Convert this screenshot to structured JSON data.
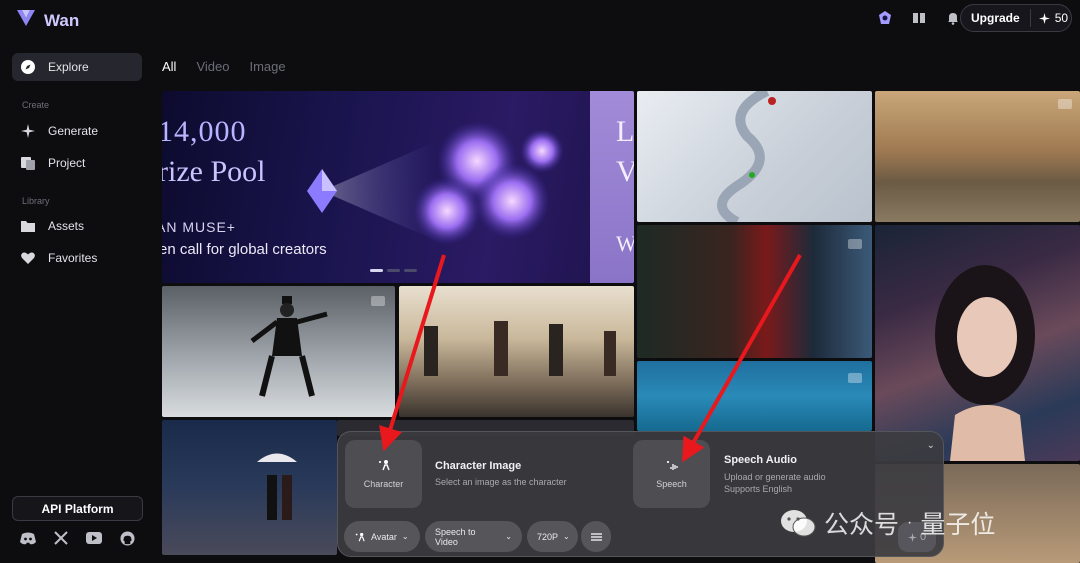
{
  "app": {
    "name": "Wan"
  },
  "header": {
    "upgrade_label": "Upgrade",
    "credits": "50"
  },
  "sidebar": {
    "explore": "Explore",
    "create_section": "Create",
    "generate": "Generate",
    "project": "Project",
    "library_section": "Library",
    "assets": "Assets",
    "favorites": "Favorites",
    "api_platform": "API Platform"
  },
  "tabs": [
    {
      "label": "All",
      "active": true
    },
    {
      "label": "Video",
      "active": false
    },
    {
      "label": "Image",
      "active": false
    }
  ],
  "banner": {
    "line1": "14,000",
    "line2": "rize Pool",
    "line3": "AN MUSE+",
    "line4": "en call for global creators",
    "side_letters": [
      "L",
      "V",
      "W"
    ]
  },
  "panel": {
    "character_slot_label": "Character",
    "character_title": "Character Image",
    "character_sub": "Select an image as the character",
    "speech_slot_label": "Speech",
    "speech_title": "Speech Audio",
    "speech_sub1": "Upload or generate audio",
    "speech_sub2": "Supports English",
    "chip_avatar": "Avatar",
    "chip_mode": "Speech to Video",
    "chip_resolution": "720P",
    "send_count": "0"
  },
  "watermark": {
    "brand": "公众号",
    "name": "量子位"
  },
  "colors": {
    "accent": "#b8b0ff",
    "arrow": "#e8181c",
    "panel": "#3c3c40"
  }
}
